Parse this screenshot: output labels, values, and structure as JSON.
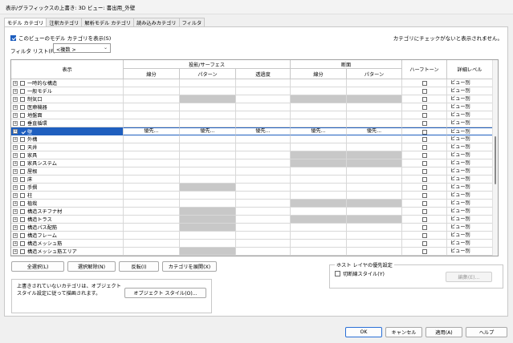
{
  "window": {
    "title": "表示/グラフィックスの上書き: 3D ビュー: 書出用_外壁"
  },
  "tabs": [
    {
      "label": "モデル カテゴリ",
      "active": true
    },
    {
      "label": "注釈カテゴリ",
      "active": false
    },
    {
      "label": "解析モデル カテゴリ",
      "active": false
    },
    {
      "label": "読み込みカテゴリ",
      "active": false
    },
    {
      "label": "フィルタ",
      "active": false
    }
  ],
  "show_categories": {
    "label": "このビューのモデル カテゴリを表示(S)",
    "checked": true
  },
  "hint": "カテゴリにチェックがないと表示されません。",
  "filter": {
    "label": "フィルタ リスト(F):",
    "value": "<複数 >"
  },
  "grid": {
    "headers": {
      "visibility": "表示",
      "projection": "投影/サーフェス",
      "cut": "断面",
      "halftone": "ハーフトーン",
      "detail": "詳細レベル",
      "lines": "線分",
      "patterns": "パターン",
      "transparency": "透過度",
      "cut_lines": "線分",
      "cut_patterns": "パターン"
    },
    "override_label": "優先...",
    "rows": [
      {
        "name": "一時的な構造",
        "checked": false,
        "gray": [],
        "detail": "ビュー別"
      },
      {
        "name": "一般モデル",
        "checked": false,
        "gray": [],
        "detail": "ビュー別"
      },
      {
        "name": "制気口",
        "checked": false,
        "gray": [
          2,
          4,
          5
        ],
        "detail": "ビュー別"
      },
      {
        "name": "医療機器",
        "checked": false,
        "gray": [],
        "detail": "ビュー別"
      },
      {
        "name": "地盤面",
        "checked": false,
        "gray": [],
        "detail": "ビュー別"
      },
      {
        "name": "垂直循環",
        "checked": false,
        "gray": [],
        "detail": "ビュー別"
      },
      {
        "name": "壁",
        "checked": true,
        "gray": [],
        "detail": "ビュー別",
        "selected": true
      },
      {
        "name": "外構",
        "checked": false,
        "gray": [],
        "detail": "ビュー別"
      },
      {
        "name": "天井",
        "checked": false,
        "gray": [],
        "detail": "ビュー別"
      },
      {
        "name": "家具",
        "checked": false,
        "gray": [
          4,
          5
        ],
        "detail": "ビュー別"
      },
      {
        "name": "家具システム",
        "checked": false,
        "gray": [
          4,
          5
        ],
        "detail": "ビュー別"
      },
      {
        "name": "屋根",
        "checked": false,
        "gray": [],
        "detail": "ビュー別"
      },
      {
        "name": "床",
        "checked": false,
        "gray": [],
        "detail": "ビュー別"
      },
      {
        "name": "手摺",
        "checked": false,
        "gray": [
          2
        ],
        "detail": "ビュー別"
      },
      {
        "name": "柱",
        "checked": false,
        "gray": [],
        "detail": "ビュー別"
      },
      {
        "name": "植栽",
        "checked": false,
        "gray": [
          4,
          5
        ],
        "detail": "ビュー別"
      },
      {
        "name": "構造スチフナ材",
        "checked": false,
        "gray": [
          2
        ],
        "detail": "ビュー別"
      },
      {
        "name": "構造トラス",
        "checked": false,
        "gray": [
          2,
          4,
          5
        ],
        "detail": "ビュー別"
      },
      {
        "name": "構造パス配筋",
        "checked": false,
        "gray": [
          2
        ],
        "detail": "ビュー別"
      },
      {
        "name": "構造フレーム",
        "checked": false,
        "gray": [],
        "detail": "ビュー別"
      },
      {
        "name": "構造メッシュ筋",
        "checked": false,
        "gray": [],
        "detail": "ビュー別"
      },
      {
        "name": "構造メッシュ筋エリア",
        "checked": false,
        "gray": [
          2
        ],
        "detail": "ビュー別"
      }
    ]
  },
  "buttons": {
    "select_all": "全選択(L)",
    "deselect": "選択解除(N)",
    "invert": "反転(I)",
    "expand": "カテゴリを展開(X)",
    "object_styles": "オブジェクト スタイル(O)...",
    "edit": "編集(E)...",
    "ok": "OK",
    "cancel": "キャンセル",
    "apply": "適用(A)",
    "help": "ヘルプ"
  },
  "note": "上書きされていないカテゴリは、オブジェクト スタイル設定に従って描画されます。",
  "host_layers": {
    "legend": "ホスト レイヤの優先設定",
    "cut_line_label": "切断線スタイル(Y)",
    "checked": false
  }
}
